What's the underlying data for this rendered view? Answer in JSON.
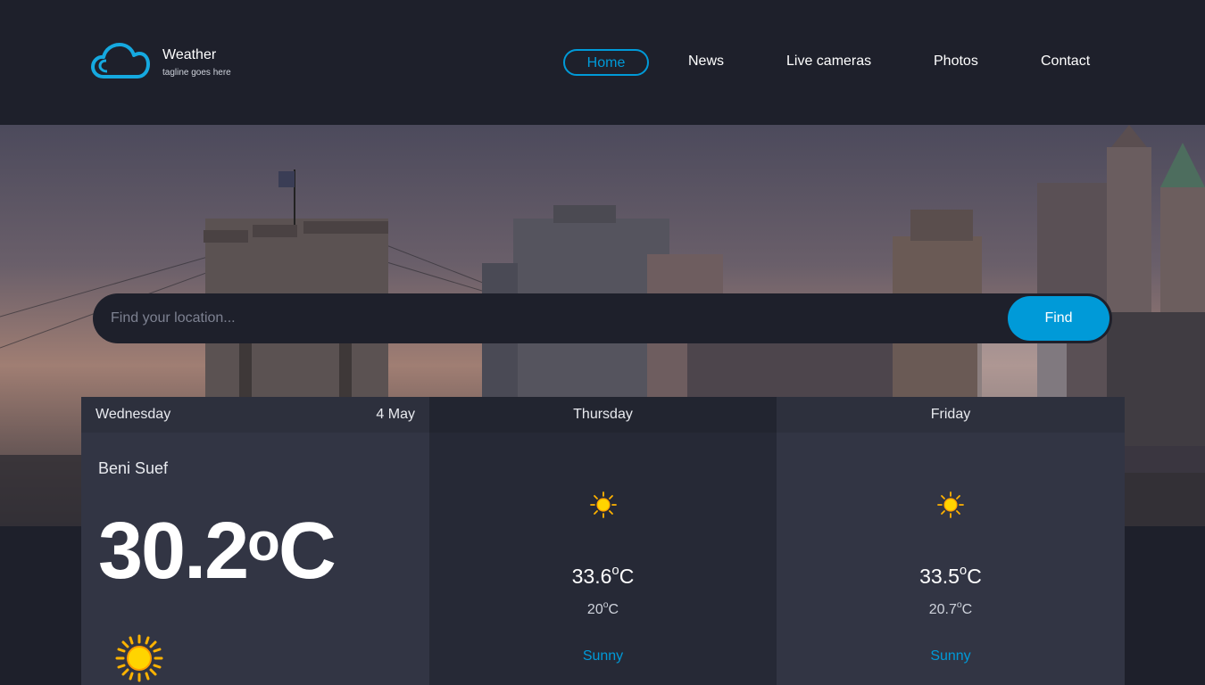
{
  "brand": {
    "title": "Weather",
    "tagline": "tagline goes here"
  },
  "nav": {
    "items": [
      "Home",
      "News",
      "Live cameras",
      "Photos",
      "Contact"
    ],
    "active": "Home"
  },
  "search": {
    "placeholder": "Find your location...",
    "button": "Find"
  },
  "colors": {
    "accent": "#009ad8",
    "background": "#1e202b",
    "card": "#323544",
    "sun": "#ffd400"
  },
  "today": {
    "day": "Wednesday",
    "date": "4 May",
    "location": "Beni Suef",
    "temp": "30.2",
    "unit_o": "o",
    "unit_c": "C",
    "icon": "sun-icon"
  },
  "forecast": [
    {
      "day": "Thursday",
      "max": "33.6",
      "min": "20",
      "condition": "Sunny",
      "icon": "sun-icon"
    },
    {
      "day": "Friday",
      "max": "33.5",
      "min": "20.7",
      "condition": "Sunny",
      "icon": "sun-icon"
    }
  ],
  "units": {
    "o": "o",
    "c": "C"
  }
}
